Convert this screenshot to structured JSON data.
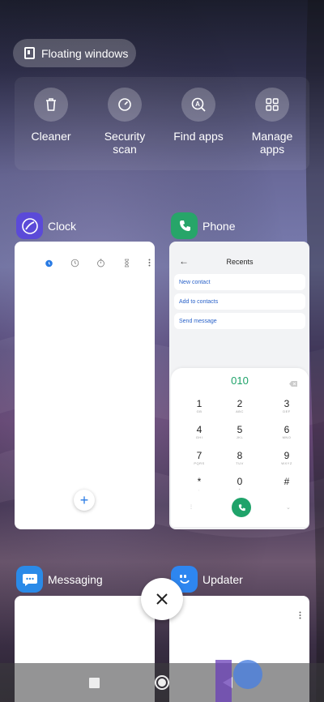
{
  "floating_windows": {
    "label": "Floating windows"
  },
  "quick_actions": [
    {
      "label": "Cleaner",
      "icon": "trash-icon"
    },
    {
      "label": "Security scan",
      "icon": "security-gauge-icon"
    },
    {
      "label": "Find apps",
      "icon": "find-apps-icon"
    },
    {
      "label": "Manage apps",
      "icon": "grid-icon"
    }
  ],
  "apps": {
    "clock": {
      "name": "Clock",
      "icon": "clock-app-icon",
      "color": "#5b4ad8"
    },
    "phone": {
      "name": "Phone",
      "icon": "phone-app-icon",
      "color": "#27a569",
      "screen_title": "Recents",
      "actions": [
        "New contact",
        "Add to contacts",
        "Send message"
      ],
      "dialed_number": "010",
      "keys": [
        {
          "digit": "1",
          "letters": "GB"
        },
        {
          "digit": "2",
          "letters": "ABC"
        },
        {
          "digit": "3",
          "letters": "DEF"
        },
        {
          "digit": "4",
          "letters": "GHI"
        },
        {
          "digit": "5",
          "letters": "JKL"
        },
        {
          "digit": "6",
          "letters": "MNO"
        },
        {
          "digit": "7",
          "letters": "PQRS"
        },
        {
          "digit": "8",
          "letters": "TUV"
        },
        {
          "digit": "9",
          "letters": "WXYZ"
        },
        {
          "digit": "*",
          "letters": ","
        },
        {
          "digit": "0",
          "letters": "+"
        },
        {
          "digit": "#",
          "letters": ""
        }
      ]
    },
    "messaging": {
      "name": "Messaging",
      "icon": "messaging-app-icon",
      "color": "#2a8ae8"
    },
    "updater": {
      "name": "Updater",
      "icon": "updater-app-icon",
      "color": "#2e86f0"
    }
  },
  "accent": "#2a7be4"
}
